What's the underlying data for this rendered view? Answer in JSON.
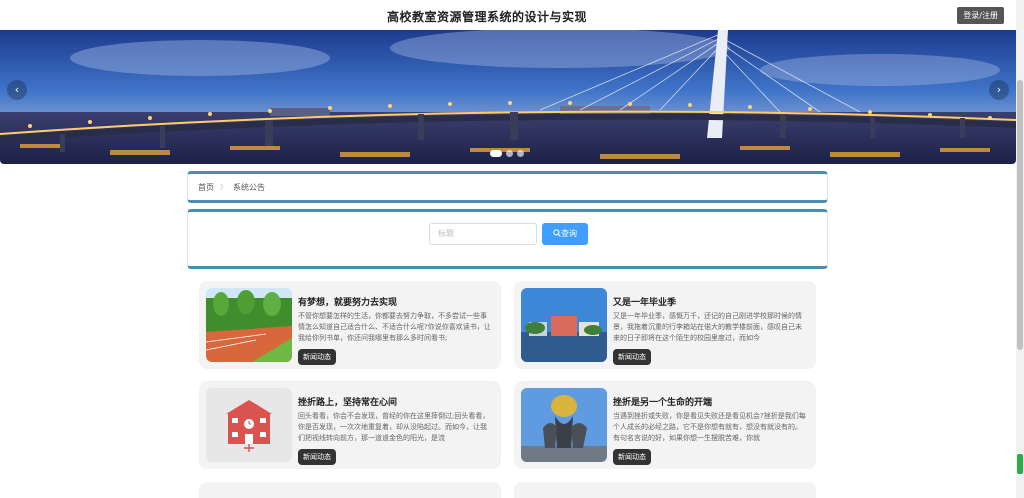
{
  "header": {
    "title": "高校教室资源管理系统的设计与实现",
    "login_label": "登录/注册"
  },
  "banner": {
    "prev_glyph": "‹",
    "next_glyph": "›",
    "slide_count": 3,
    "active_slide": 1
  },
  "breadcrumb": {
    "home": "首页",
    "separator": "〉",
    "current": "系统公告"
  },
  "search": {
    "placeholder": "标题",
    "button_label": "查询"
  },
  "news": [
    {
      "title": "有梦想，就要努力去实现",
      "summary": "不管你想要怎样的生活，你都要去努力争取，不多尝试一些事情怎么知道自己适合什么、不适合什么呢?你说你喜欢读书，让我给你列书单，你还问我哪里有那么多时间看书;",
      "tag": "新闻动态"
    },
    {
      "title": "又是一年毕业季",
      "summary": "又是一年毕业季，感慨万千，还记的自己刚进学校那时候的情景，我拖着沉重的行李箱站在偌大的教学楼前面，感叹自己未来的日子即将在这个陌生的校园里度过，而如今",
      "tag": "新闻动态"
    },
    {
      "title": "挫折路上，坚持常在心间",
      "summary": "回头看看，你会不会发现，曾经的你在这里摔倒过;回头看看，你是否发现，一次次地重复着，却从没陷起过。而如今，让我们把视线转向前方，那一道道金色的阳光，是流",
      "tag": "新闻动态"
    },
    {
      "title": "挫折是另一个生命的开端",
      "summary": "当遇到挫折或失败，你是看见失败还是看见机会?挫折是我们每个人成长的必经之路，它不是你想有就有，想没有就没有的。有句名言说的好，如果你想一生摆脱苦难，你就",
      "tag": "新闻动态"
    }
  ],
  "colors": {
    "accent": "#409eff",
    "panel_border": "#4a8fb3",
    "card_bg": "#f3f3f3",
    "tag_bg": "#333333",
    "scroll_mark": "#2ea94b"
  }
}
